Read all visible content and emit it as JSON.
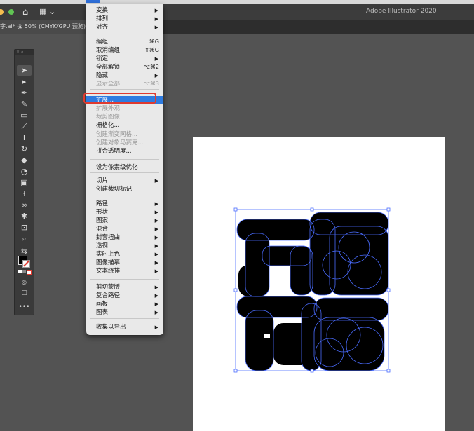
{
  "window": {
    "app_title": "Adobe Illustrator 2020",
    "document_tab": "字.ai* @ 50% (CMYK/GPU 预览)"
  },
  "menu": {
    "items": [
      {
        "label": "变换",
        "shortcut": "",
        "submenu": true,
        "disabled": false
      },
      {
        "label": "排列",
        "shortcut": "",
        "submenu": true,
        "disabled": false
      },
      {
        "label": "对齐",
        "shortcut": "",
        "submenu": true,
        "disabled": false
      },
      {
        "label": "编组",
        "shortcut": "⌘G",
        "submenu": false,
        "disabled": false
      },
      {
        "label": "取消编组",
        "shortcut": "⇧⌘G",
        "submenu": false,
        "disabled": false
      },
      {
        "label": "锁定",
        "shortcut": "",
        "submenu": true,
        "disabled": false
      },
      {
        "label": "全部解锁",
        "shortcut": "⌥⌘2",
        "submenu": false,
        "disabled": false
      },
      {
        "label": "隐藏",
        "shortcut": "",
        "submenu": true,
        "disabled": false
      },
      {
        "label": "显示全部",
        "shortcut": "⌥⌘3",
        "submenu": false,
        "disabled": true
      },
      {
        "label": "扩展...",
        "shortcut": "",
        "submenu": false,
        "disabled": false,
        "highlighted": true
      },
      {
        "label": "扩展外观",
        "shortcut": "",
        "submenu": false,
        "disabled": true
      },
      {
        "label": "裁剪图像",
        "shortcut": "",
        "submenu": false,
        "disabled": true
      },
      {
        "label": "栅格化...",
        "shortcut": "",
        "submenu": false,
        "disabled": false
      },
      {
        "label": "创建渐变网格...",
        "shortcut": "",
        "submenu": false,
        "disabled": true
      },
      {
        "label": "创建对象马赛克...",
        "shortcut": "",
        "submenu": false,
        "disabled": true
      },
      {
        "label": "拼合透明度...",
        "shortcut": "",
        "submenu": false,
        "disabled": false
      },
      {
        "label": "设为像素级优化",
        "shortcut": "",
        "submenu": false,
        "disabled": false
      },
      {
        "label": "切片",
        "shortcut": "",
        "submenu": true,
        "disabled": false
      },
      {
        "label": "创建裁切标记",
        "shortcut": "",
        "submenu": false,
        "disabled": false
      },
      {
        "label": "路径",
        "shortcut": "",
        "submenu": true,
        "disabled": false
      },
      {
        "label": "形状",
        "shortcut": "",
        "submenu": true,
        "disabled": false
      },
      {
        "label": "图案",
        "shortcut": "",
        "submenu": true,
        "disabled": false
      },
      {
        "label": "混合",
        "shortcut": "",
        "submenu": true,
        "disabled": false
      },
      {
        "label": "封套扭曲",
        "shortcut": "",
        "submenu": true,
        "disabled": false
      },
      {
        "label": "透视",
        "shortcut": "",
        "submenu": true,
        "disabled": false
      },
      {
        "label": "实时上色",
        "shortcut": "",
        "submenu": true,
        "disabled": false
      },
      {
        "label": "图像描摹",
        "shortcut": "",
        "submenu": true,
        "disabled": false
      },
      {
        "label": "文本绕排",
        "shortcut": "",
        "submenu": true,
        "disabled": false
      },
      {
        "label": "剪切蒙版",
        "shortcut": "",
        "submenu": true,
        "disabled": false
      },
      {
        "label": "复合路径",
        "shortcut": "",
        "submenu": true,
        "disabled": false
      },
      {
        "label": "画板",
        "shortcut": "",
        "submenu": true,
        "disabled": false
      },
      {
        "label": "图表",
        "shortcut": "",
        "submenu": true,
        "disabled": false
      },
      {
        "label": "收集以导出",
        "shortcut": "",
        "submenu": true,
        "disabled": false
      }
    ]
  },
  "tools": [
    "selection-tool",
    "direct-selection-tool",
    "pen-tool",
    "curvature-tool",
    "rectangle-tool",
    "paintbrush-tool",
    "type-tool",
    "rotate-tool",
    "eraser-tool",
    "shape-builder-tool",
    "gradient-tool",
    "eyedropper-tool",
    "blend-tool",
    "symbol-sprayer-tool",
    "artboard-tool",
    "zoom-tool",
    "fill-stroke-swatches",
    "draw-mode-icon",
    "screen-mode-icon",
    "more-tools-icon"
  ],
  "colors": {
    "menu_highlight": "#2e7be0",
    "callout_border": "#e03a2f",
    "selection_outline": "#4a6cff",
    "artwork_fill": "#000000"
  }
}
